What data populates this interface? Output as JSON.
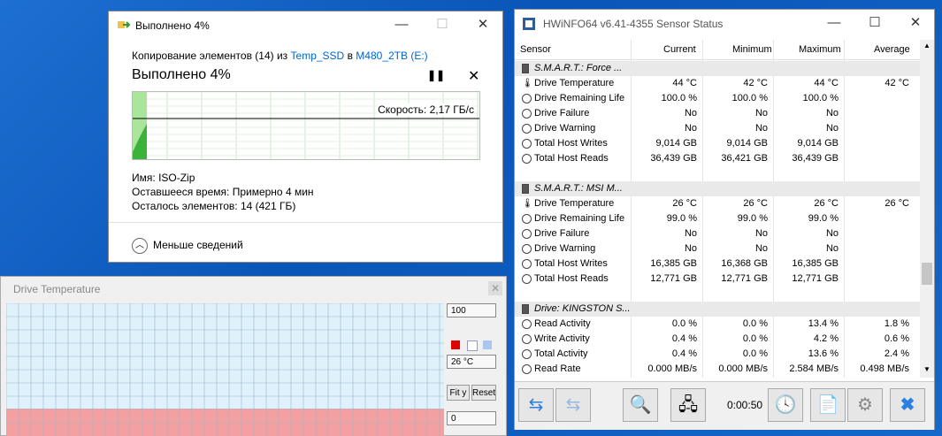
{
  "copy_dialog": {
    "title": "Выполнено 4%",
    "line_prefix": "Копирование элементов (14) из",
    "source": "Temp_SSD",
    "line_mid": "в",
    "dest": "M480_2TB (E:)",
    "heading": "Выполнено 4%",
    "speed": "Скорость: 2,17 ГБ/с",
    "name_label": "Имя:",
    "name_value": "ISO-Zip",
    "time_label": "Оставшееся время:",
    "time_value": "Примерно 4 мин",
    "items_label": "Осталось элементов:",
    "items_value": "14 (421 ГБ)",
    "less_details": "Меньше сведений",
    "progress": 0.04
  },
  "drive_temp": {
    "title": "Drive Temperature",
    "max": "100",
    "current": "26 °C",
    "min": "0",
    "fit_label": "Fit y",
    "reset_label": "Reset",
    "level": 0.26
  },
  "hwinfo": {
    "title": "HWiNFO64 v6.41-4355 Sensor Status",
    "columns": [
      "Sensor",
      "Current",
      "Minimum",
      "Maximum",
      "Average"
    ],
    "rows": [
      {
        "type": "group",
        "name": "S.M.A.R.T.: Force ..."
      },
      {
        "type": "temp",
        "name": "Drive Temperature",
        "cur": "44 °C",
        "min": "42 °C",
        "max": "44 °C",
        "avg": "42 °C"
      },
      {
        "type": "val",
        "name": "Drive Remaining Life",
        "cur": "100.0 %",
        "min": "100.0 %",
        "max": "100.0 %",
        "avg": ""
      },
      {
        "type": "val",
        "name": "Drive Failure",
        "cur": "No",
        "min": "No",
        "max": "No",
        "avg": ""
      },
      {
        "type": "val",
        "name": "Drive Warning",
        "cur": "No",
        "min": "No",
        "max": "No",
        "avg": ""
      },
      {
        "type": "val",
        "name": "Total Host Writes",
        "cur": "9,014 GB",
        "min": "9,014 GB",
        "max": "9,014 GB",
        "avg": ""
      },
      {
        "type": "val",
        "name": "Total Host Reads",
        "cur": "36,439 GB",
        "min": "36,421 GB",
        "max": "36,439 GB",
        "avg": ""
      },
      {
        "type": "blank",
        "name": ""
      },
      {
        "type": "group",
        "name": "S.M.A.R.T.: MSI M..."
      },
      {
        "type": "temp",
        "name": "Drive Temperature",
        "cur": "26 °C",
        "min": "26 °C",
        "max": "26 °C",
        "avg": "26 °C"
      },
      {
        "type": "val",
        "name": "Drive Remaining Life",
        "cur": "99.0 %",
        "min": "99.0 %",
        "max": "99.0 %",
        "avg": ""
      },
      {
        "type": "val",
        "name": "Drive Failure",
        "cur": "No",
        "min": "No",
        "max": "No",
        "avg": ""
      },
      {
        "type": "val",
        "name": "Drive Warning",
        "cur": "No",
        "min": "No",
        "max": "No",
        "avg": ""
      },
      {
        "type": "val",
        "name": "Total Host Writes",
        "cur": "16,385 GB",
        "min": "16,368 GB",
        "max": "16,385 GB",
        "avg": ""
      },
      {
        "type": "val",
        "name": "Total Host Reads",
        "cur": "12,771 GB",
        "min": "12,771 GB",
        "max": "12,771 GB",
        "avg": ""
      },
      {
        "type": "blank",
        "name": ""
      },
      {
        "type": "group",
        "name": "Drive: KINGSTON S..."
      },
      {
        "type": "val",
        "name": "Read Activity",
        "cur": "0.0 %",
        "min": "0.0 %",
        "max": "13.4 %",
        "avg": "1.8 %"
      },
      {
        "type": "val",
        "name": "Write Activity",
        "cur": "0.4 %",
        "min": "0.0 %",
        "max": "4.2 %",
        "avg": "0.6 %"
      },
      {
        "type": "val",
        "name": "Total Activity",
        "cur": "0.4 %",
        "min": "0.0 %",
        "max": "13.6 %",
        "avg": "2.4 %"
      },
      {
        "type": "val",
        "name": "Read Rate",
        "cur": "0.000 MB/s",
        "min": "0.000 MB/s",
        "max": "2.584 MB/s",
        "avg": "0.498 MB/s"
      }
    ],
    "timer": "0:00:50"
  }
}
